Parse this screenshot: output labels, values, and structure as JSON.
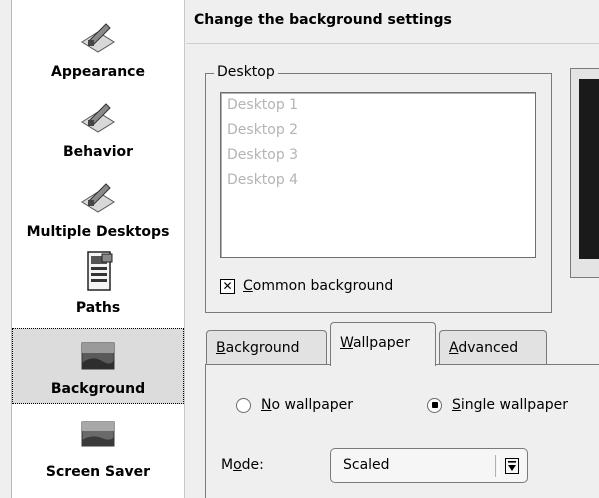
{
  "sidebar": {
    "items": [
      {
        "label": "Appearance",
        "icon": "appearance-icon"
      },
      {
        "label": "Behavior",
        "icon": "behavior-icon"
      },
      {
        "label": "Multiple Desktops",
        "icon": "multiple-desktops-icon"
      },
      {
        "label": "Paths",
        "icon": "paths-icon"
      },
      {
        "label": "Background",
        "icon": "background-icon",
        "selected": true
      },
      {
        "label": "Screen Saver",
        "icon": "screen-saver-icon"
      }
    ]
  },
  "header": {
    "title": "Change the background settings"
  },
  "desktop_group": {
    "legend": "Desktop",
    "desktops": [
      "Desktop 1",
      "Desktop 2",
      "Desktop 3",
      "Desktop 4"
    ],
    "common_background": {
      "label_underlined": "C",
      "label_rest": "ommon background",
      "checked": true,
      "mark": "✕"
    }
  },
  "tabs": [
    {
      "underlined": "B",
      "rest": "ackground",
      "active": false
    },
    {
      "underlined": "W",
      "rest": "allpaper",
      "active": true
    },
    {
      "underlined": "A",
      "rest": "dvanced",
      "active": false
    }
  ],
  "wallpaper": {
    "no_wallpaper": {
      "underlined": "N",
      "rest": "o wallpaper",
      "selected": false
    },
    "single_wallpaper": {
      "underlined": "S",
      "rest": "ingle wallpaper",
      "selected": true
    },
    "mode": {
      "label_pre": "M",
      "label_underlined": "o",
      "label_post": "de:",
      "value": "Scaled"
    }
  },
  "colors": {
    "selected_bg": "#dcdcdc",
    "window_bg": "#efefef",
    "disabled_text": "#b4b4b4"
  }
}
